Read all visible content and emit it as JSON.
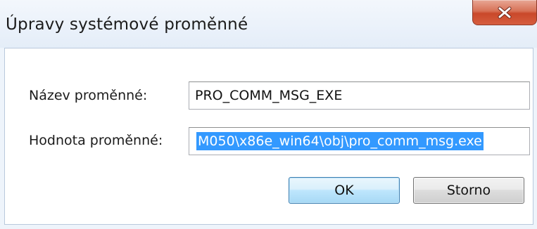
{
  "window": {
    "title": "Úpravy systémové proměnné",
    "close_icon": "close-x-icon"
  },
  "form": {
    "name_label": "Název proměnné:",
    "name_value": "PRO_COMM_MSG_EXE",
    "value_label": "Hodnota proměnné:",
    "value_value": "M050\\x86e_win64\\obj\\pro_comm_msg.exe"
  },
  "buttons": {
    "ok_label": "OK",
    "cancel_label": "Storno"
  },
  "colors": {
    "selection": "#3399ff",
    "close_button": "#c9482a"
  }
}
